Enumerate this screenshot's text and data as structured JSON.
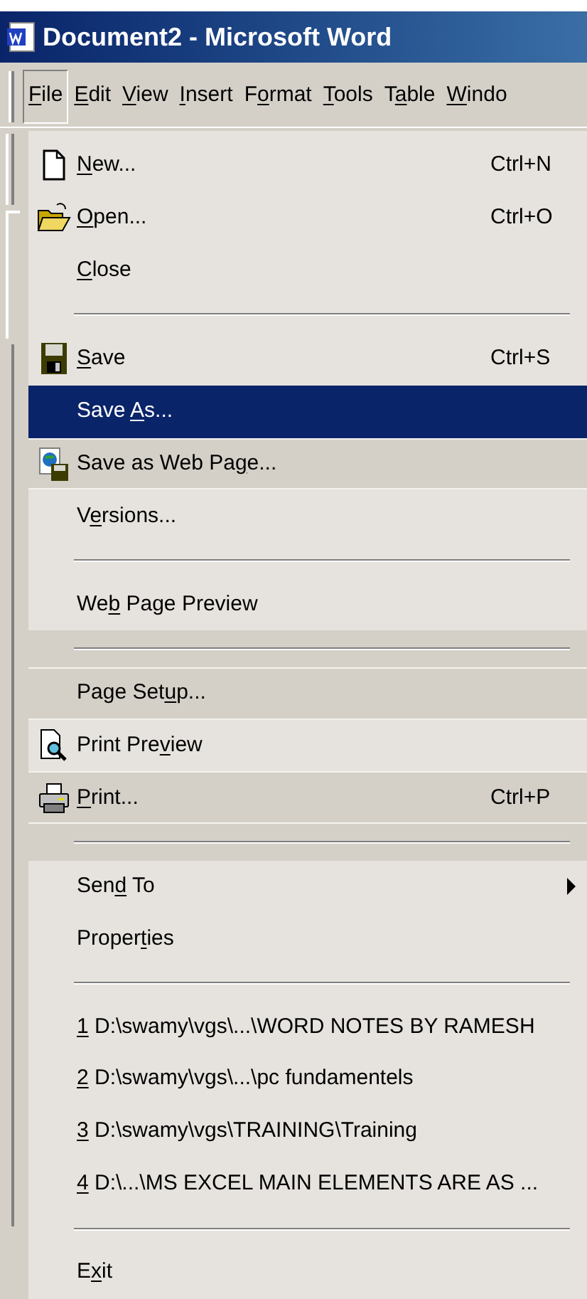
{
  "window": {
    "title": "Document2 - Microsoft Word"
  },
  "menu_bar": [
    {
      "key": "F",
      "post": "ile",
      "selected": true
    },
    {
      "key": "E",
      "post": "dit",
      "selected": false
    },
    {
      "key": "V",
      "post": "iew",
      "selected": false
    },
    {
      "key": "I",
      "post": "nsert",
      "selected": false
    },
    {
      "pre": "F",
      "key": "o",
      "post": "rmat",
      "selected": false
    },
    {
      "key": "T",
      "post": "ools",
      "selected": false
    },
    {
      "pre": "T",
      "key": "a",
      "post": "ble",
      "selected": false
    },
    {
      "key": "W",
      "post": "indo",
      "selected": false
    }
  ],
  "file_menu": [
    {
      "kind": "item",
      "key": "N",
      "post": "ew...",
      "shortcut": "Ctrl+N",
      "selected": false,
      "recessed": false
    },
    {
      "kind": "item",
      "key": "O",
      "post": "pen...",
      "shortcut": "Ctrl+O",
      "selected": false,
      "recessed": false
    },
    {
      "kind": "item",
      "key": "C",
      "post": "lose",
      "selected": false,
      "recessed": false
    },
    {
      "kind": "separator"
    },
    {
      "kind": "item",
      "key": "S",
      "post": "ave",
      "shortcut": "Ctrl+S",
      "selected": false,
      "recessed": false
    },
    {
      "kind": "item",
      "pre": "Save ",
      "key": "A",
      "post": "s...",
      "selected": true,
      "recessed": false
    },
    {
      "kind": "item",
      "pre": "Save as Web Pa",
      "key": "g",
      "post": "e...",
      "selected": false,
      "recessed": true
    },
    {
      "kind": "item",
      "pre": "V",
      "key": "e",
      "post": "rsions...",
      "selected": false,
      "recessed": false
    },
    {
      "kind": "separator"
    },
    {
      "kind": "item",
      "pre": "We",
      "key": "b",
      "post": " Page Preview",
      "selected": false,
      "recessed": false
    },
    {
      "kind": "separator"
    },
    {
      "kind": "item",
      "pre": "Page Set",
      "key": "u",
      "post": "p...",
      "selected": false,
      "recessed": true
    },
    {
      "kind": "item",
      "pre": "Print Pre",
      "key": "v",
      "post": "iew",
      "selected": false,
      "recessed": false
    },
    {
      "kind": "item",
      "key": "P",
      "post": "rint...",
      "shortcut": "Ctrl+P",
      "selected": false,
      "recessed": true
    },
    {
      "kind": "separator"
    },
    {
      "kind": "item",
      "pre": "Sen",
      "key": "d",
      "post": " To",
      "submenu": true,
      "selected": false,
      "recessed": false
    },
    {
      "kind": "item",
      "pre": "Proper",
      "key": "t",
      "post": "ies",
      "selected": false,
      "recessed": false
    },
    {
      "kind": "separator"
    },
    {
      "kind": "item",
      "key": "1",
      "post": " D:\\swamy\\vgs\\...\\WORD NOTES BY RAMESH",
      "selected": false,
      "recessed": false
    },
    {
      "kind": "item",
      "key": "2",
      "post": " D:\\swamy\\vgs\\...\\pc fundamentels",
      "selected": false,
      "recessed": false
    },
    {
      "kind": "item",
      "key": "3",
      "post": " D:\\swamy\\vgs\\TRAINING\\Training",
      "selected": false,
      "recessed": false
    },
    {
      "kind": "item",
      "key": "4",
      "post": " D:\\...\\MS EXCEL MAIN ELEMENTS ARE AS ...",
      "selected": false,
      "recessed": false
    },
    {
      "kind": "separator"
    },
    {
      "kind": "item",
      "pre": "E",
      "key": "x",
      "post": "it",
      "selected": false,
      "recessed": false
    }
  ]
}
